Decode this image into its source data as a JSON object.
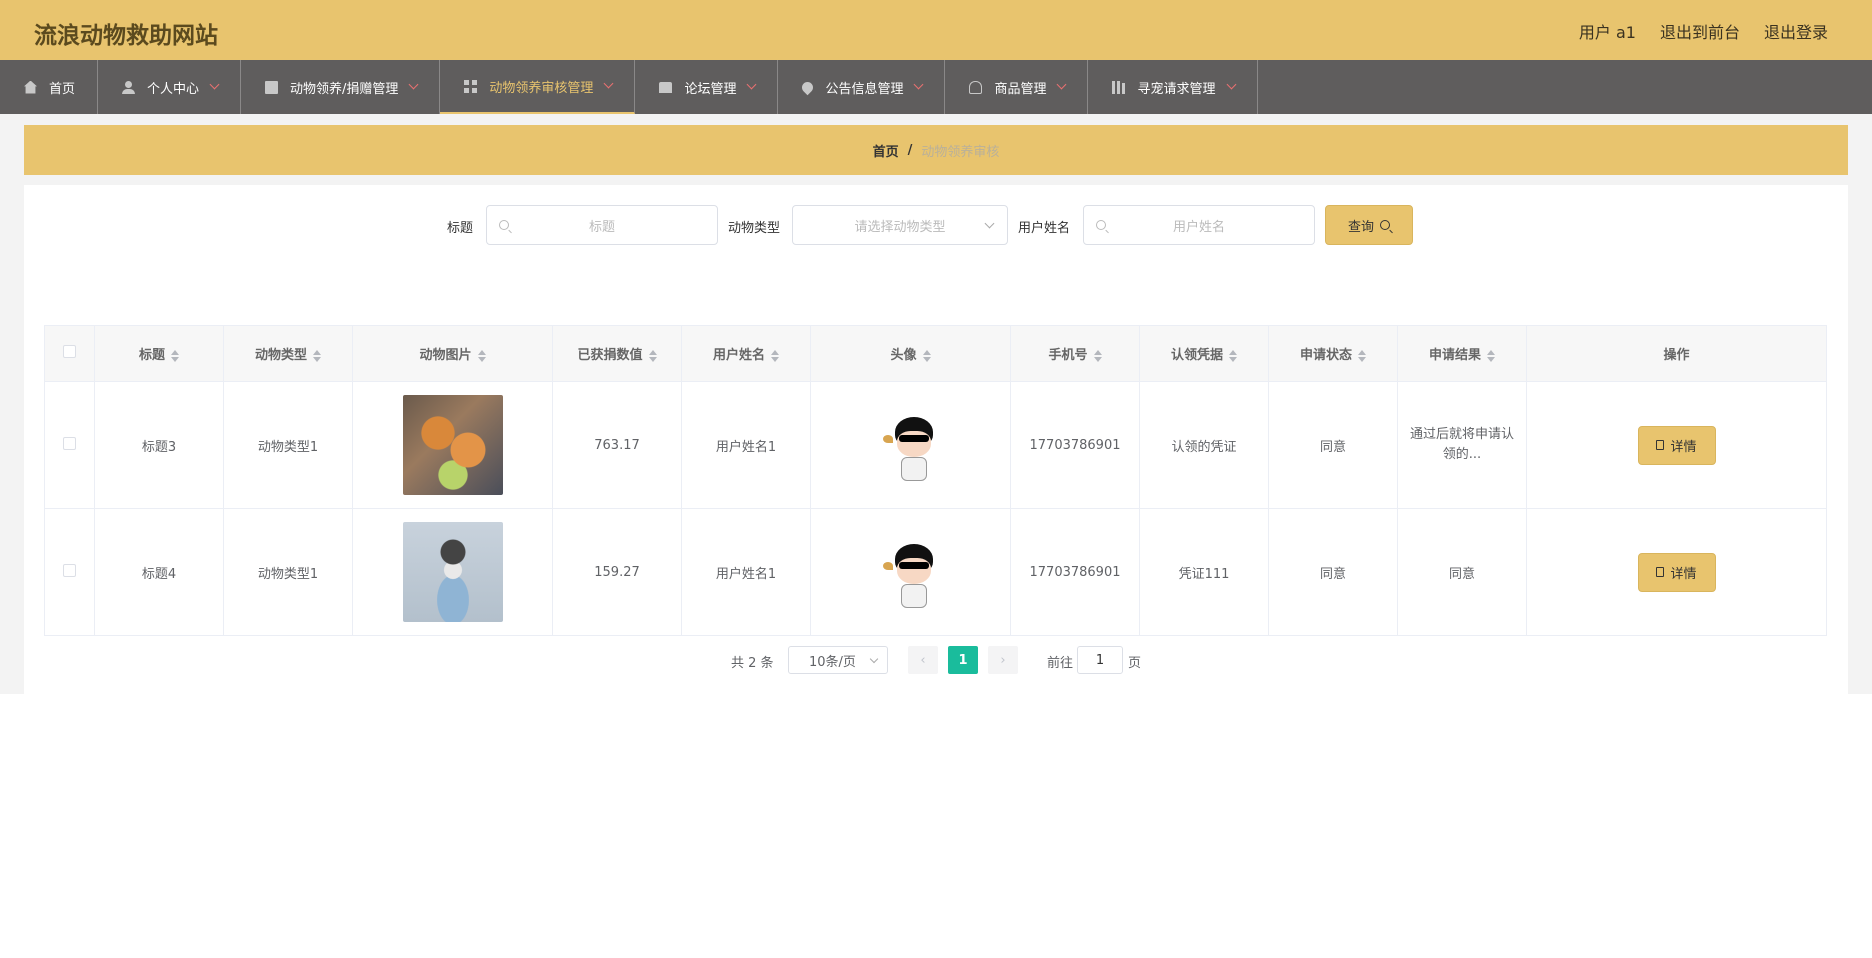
{
  "header": {
    "title": "流浪动物救助网站",
    "user": "用户 a1",
    "to_front": "退出到前台",
    "logout": "退出登录"
  },
  "nav": [
    {
      "label": "首页",
      "icon": "home-icon"
    },
    {
      "label": "个人中心",
      "icon": "user-icon"
    },
    {
      "label": "动物领养/捐赠管理",
      "icon": "clipboard-icon"
    },
    {
      "label": "动物领养审核管理",
      "icon": "grid-icon",
      "active": true
    },
    {
      "label": "论坛管理",
      "icon": "book-icon"
    },
    {
      "label": "公告信息管理",
      "icon": "pin-icon"
    },
    {
      "label": "商品管理",
      "icon": "bell-icon"
    },
    {
      "label": "寻宠请求管理",
      "icon": "bars-icon"
    }
  ],
  "breadcrumb": {
    "home": "首页",
    "sep": "/",
    "current": "动物领养审核"
  },
  "search": {
    "title_label": "标题",
    "title_placeholder": "标题",
    "type_label": "动物类型",
    "type_placeholder": "请选择动物类型",
    "name_label": "用户姓名",
    "name_placeholder": "用户姓名",
    "query_label": "查询"
  },
  "table": {
    "headers": [
      "标题",
      "动物类型",
      "动物图片",
      "已获捐数值",
      "用户姓名",
      "头像",
      "手机号",
      "认领凭据",
      "申请状态",
      "申请结果",
      "操作"
    ],
    "rows": [
      {
        "title": "标题3",
        "type": "动物类型1",
        "donation": "763.17",
        "name": "用户姓名1",
        "phone": "17703786901",
        "proof": "认领的凭证",
        "status": "同意",
        "result": "通过后就将申请认领的..."
      },
      {
        "title": "标题4",
        "type": "动物类型1",
        "donation": "159.27",
        "name": "用户姓名1",
        "phone": "17703786901",
        "proof": "凭证111",
        "status": "同意",
        "result": "同意"
      }
    ],
    "detail_label": "详情"
  },
  "pager": {
    "total": "共 2 条",
    "size": "10条/页",
    "prev": "‹",
    "current": "1",
    "next": "›",
    "goto": "前往",
    "goto_value": "1",
    "page_suffix": "页"
  },
  "colors": {
    "accent": "#e8c46e",
    "nav_bg": "#5f5d5d",
    "pager_active": "#1abc9c"
  }
}
